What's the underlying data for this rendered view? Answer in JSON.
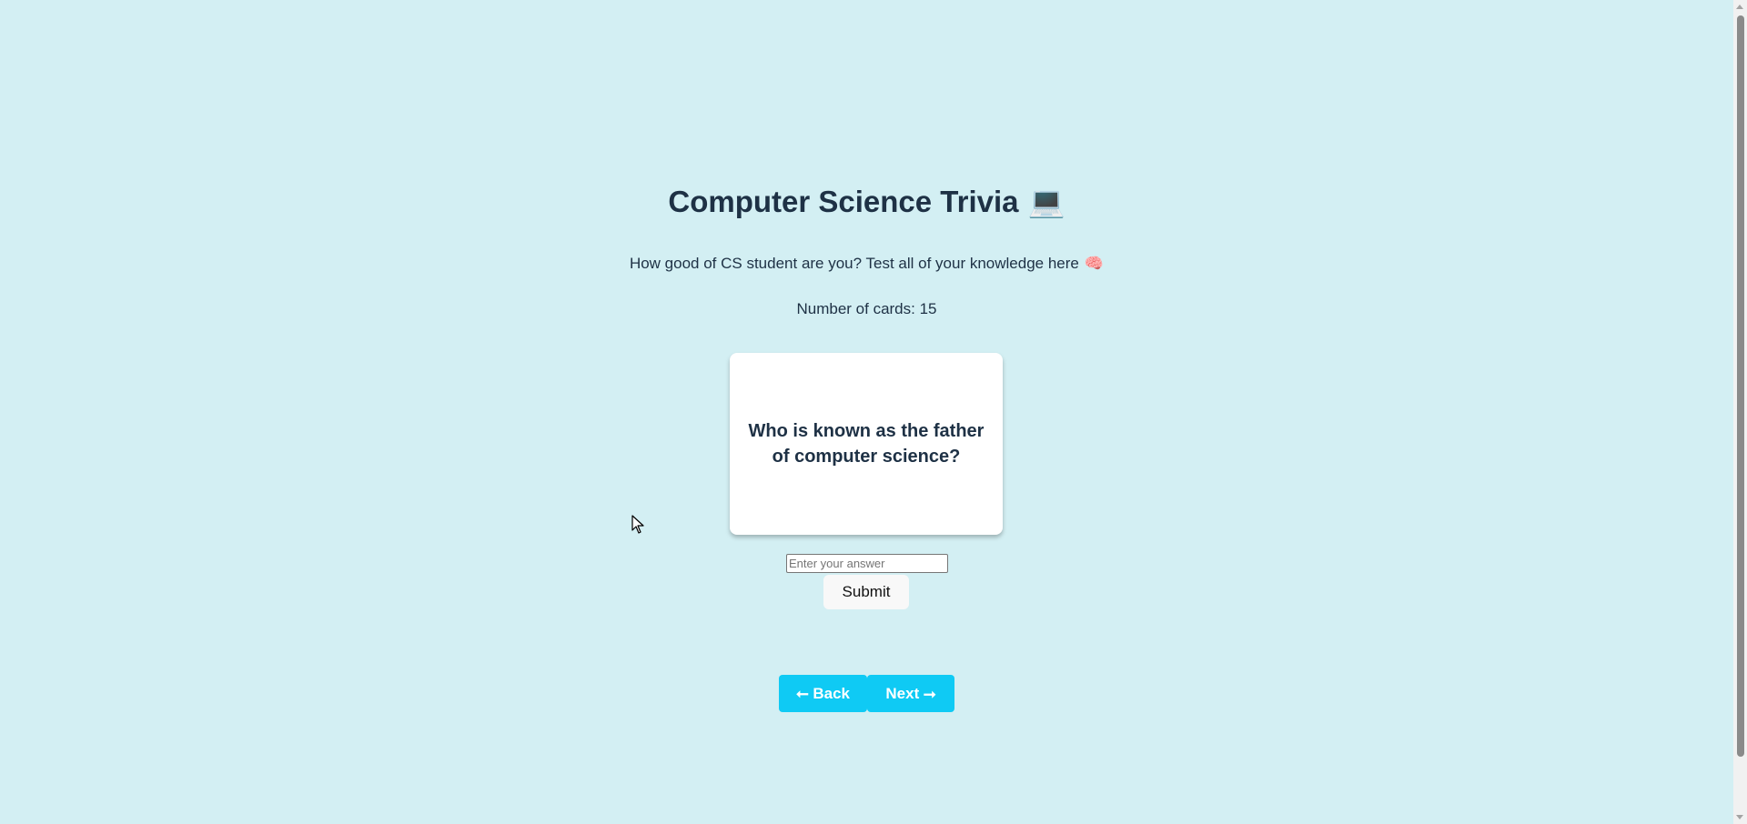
{
  "header": {
    "title": "Computer Science Trivia",
    "title_emoji": "💻",
    "subtitle": "How good of CS student are you? Test all of your knowledge here",
    "subtitle_emoji": "🧠",
    "card_count_text": "Number of cards: 15"
  },
  "card": {
    "question": "Who is known as the father of computer science?"
  },
  "answer": {
    "placeholder": "Enter your answer",
    "value": "",
    "submit_label": "Submit"
  },
  "navigation": {
    "back_label": "⭠ Back",
    "next_label": "Next ⭢"
  },
  "colors": {
    "background": "#d3eff3",
    "text": "#1e3145",
    "nav_button": "#0fcaf4",
    "card": "#ffffff"
  }
}
